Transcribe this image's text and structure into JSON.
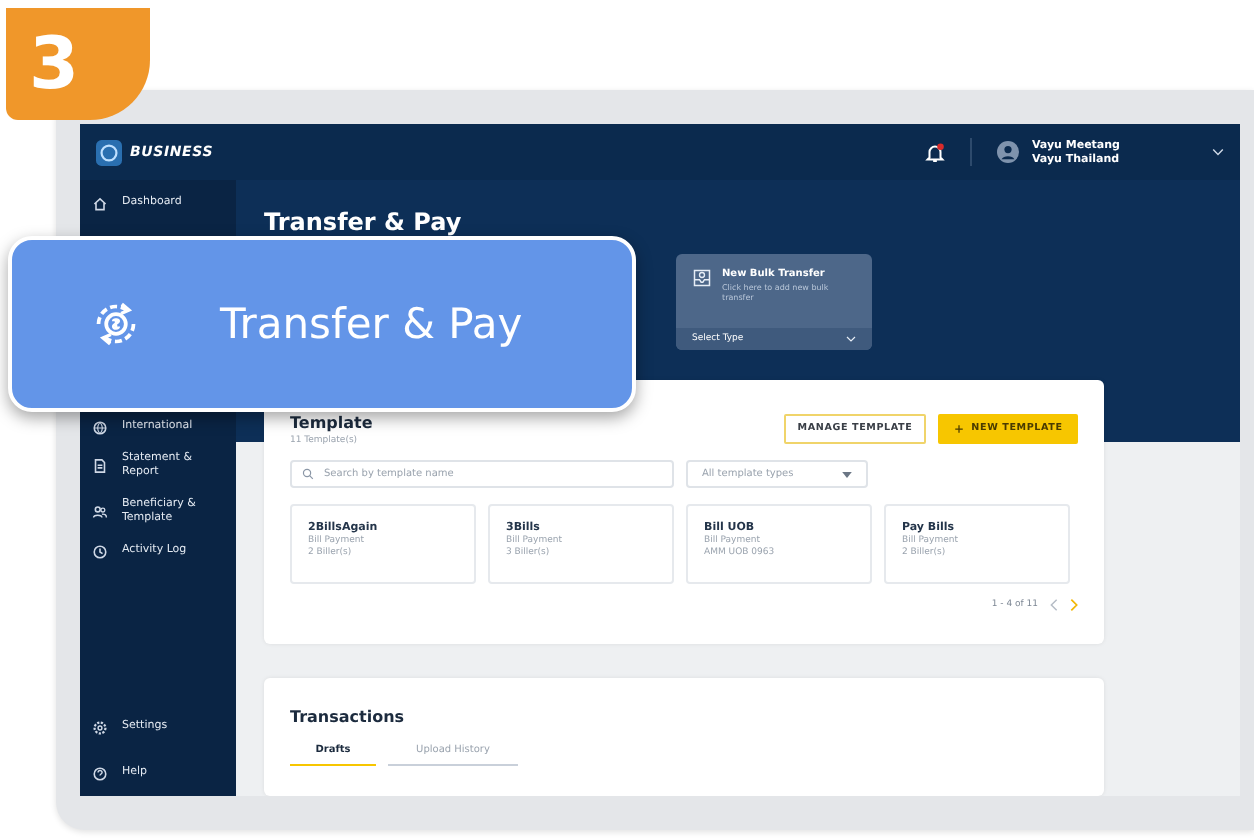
{
  "step_badge": "3",
  "callout": {
    "label": "Transfer & Pay"
  },
  "header": {
    "logo": "BUSINESS",
    "user": {
      "name": "Vayu Meetang",
      "company": "Vayu Thailand"
    }
  },
  "sidebar": {
    "items": [
      {
        "label": "Dashboard",
        "kind": "home"
      },
      {
        "label": "International",
        "kind": "globe"
      },
      {
        "label": "Statement & Report",
        "kind": "document"
      },
      {
        "label": "Beneficiary & Template",
        "kind": "people"
      },
      {
        "label": "Activity Log",
        "kind": "clock"
      }
    ],
    "footer_items": [
      {
        "label": "Settings",
        "kind": "gear"
      },
      {
        "label": "Help",
        "kind": "help"
      }
    ]
  },
  "page_title": "Transfer & Pay",
  "quick_actions": [
    {
      "title": "New Bulk Transfer",
      "description": "Click here to add new bulk transfer",
      "select": "Select Type"
    }
  ],
  "template": {
    "title": "Template",
    "count": "11 Template(s)",
    "buttons": [
      {
        "label": "MANAGE TEMPLATE",
        "kind": "outline"
      },
      {
        "label": "NEW TEMPLATE",
        "kind": "primary"
      }
    ],
    "search": {
      "placeholder": "Search by template name"
    },
    "type_filter": "All template types",
    "items": [
      {
        "name": "2BillsAgain",
        "type": "Bill Payment",
        "detail": "2 Biller(s)"
      },
      {
        "name": "3Bills",
        "type": "Bill Payment",
        "detail": "3 Biller(s)"
      },
      {
        "name": "Bill UOB",
        "type": "Bill Payment",
        "detail": "AMM UOB 0963"
      },
      {
        "name": "Pay Bills",
        "type": "Bill Payment",
        "detail": "2 Biller(s)"
      }
    ],
    "pagination": "1 - 4 of 11"
  },
  "transactions": {
    "title": "Transactions",
    "tabs": [
      {
        "label": "Drafts",
        "selected": true
      },
      {
        "label": "Upload History",
        "selected": false
      }
    ]
  }
}
